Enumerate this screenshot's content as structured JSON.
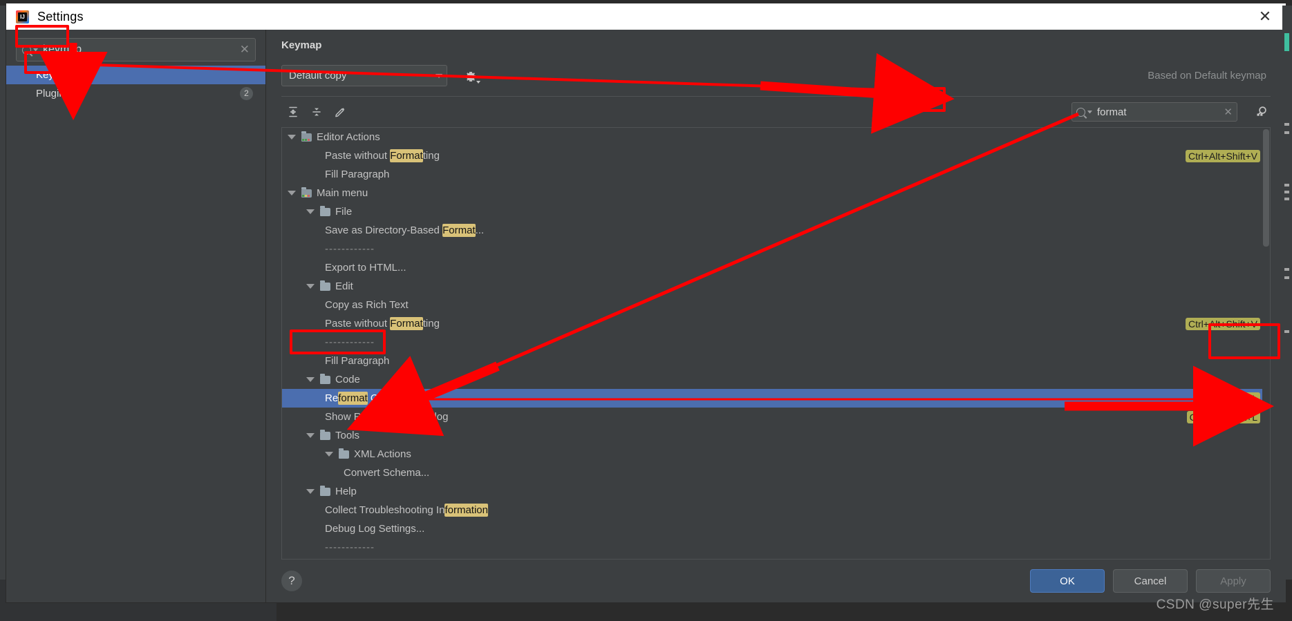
{
  "window": {
    "title": "Settings",
    "logo_icon": "intellij-idea-logo",
    "close_icon": "close-icon"
  },
  "sidebar": {
    "search": {
      "value": "keymap",
      "placeholder": "",
      "icon": "search-icon",
      "clear_icon": "clear-icon"
    },
    "items": [
      {
        "label": "Keymap",
        "selected": true,
        "badge": ""
      },
      {
        "label": "Plugins",
        "selected": false,
        "badge": "2"
      }
    ]
  },
  "main": {
    "page_title": "Keymap",
    "keymap_select": {
      "value": "Default copy",
      "caret_icon": "chevron-down-icon"
    },
    "gear_icon": "gear-icon",
    "based_on": "Based on Default keymap",
    "toolbar": {
      "expand_all_icon": "expand-all-icon",
      "collapse_all_icon": "collapse-all-icon",
      "edit_shortcut_icon": "pencil-edit-icon"
    },
    "keymap_search": {
      "value": "format",
      "icon": "search-icon",
      "clear_icon": "clear-icon"
    },
    "find_by_shortcut_icon": "find-by-shortcut-icon",
    "tree": [
      {
        "depth": 0,
        "type": "group",
        "icon": "editor-actions-icon",
        "text": "Editor Actions",
        "hl": [],
        "shortcut": ""
      },
      {
        "depth": 2,
        "type": "action",
        "icon": "",
        "text": "Paste without Formatting",
        "hl": [
          [
            "Paste without ",
            false
          ],
          [
            "Format",
            true
          ],
          [
            "ting",
            false
          ]
        ],
        "shortcut": "Ctrl+Alt+Shift+V"
      },
      {
        "depth": 2,
        "type": "action",
        "icon": "",
        "text": "Fill Paragraph",
        "hl": [],
        "shortcut": ""
      },
      {
        "depth": 0,
        "type": "group",
        "icon": "main-menu-icon",
        "text": "Main menu",
        "hl": [],
        "shortcut": ""
      },
      {
        "depth": 1,
        "type": "folder",
        "icon": "folder-icon",
        "text": "File",
        "hl": [],
        "shortcut": ""
      },
      {
        "depth": 2,
        "type": "action",
        "icon": "",
        "text": "Save as Directory-Based Format...",
        "hl": [
          [
            "Save as Directory-Based ",
            false
          ],
          [
            "Format",
            true
          ],
          [
            "...",
            false
          ]
        ],
        "shortcut": ""
      },
      {
        "depth": 2,
        "type": "separator",
        "icon": "",
        "text": "------------",
        "hl": [],
        "shortcut": ""
      },
      {
        "depth": 2,
        "type": "action",
        "icon": "",
        "text": "Export to HTML...",
        "hl": [],
        "shortcut": ""
      },
      {
        "depth": 1,
        "type": "folder",
        "icon": "folder-icon",
        "text": "Edit",
        "hl": [],
        "shortcut": ""
      },
      {
        "depth": 2,
        "type": "action",
        "icon": "",
        "text": "Copy as Rich Text",
        "hl": [],
        "shortcut": ""
      },
      {
        "depth": 2,
        "type": "action",
        "icon": "",
        "text": "Paste without Formatting",
        "hl": [
          [
            "Paste without ",
            false
          ],
          [
            "Format",
            true
          ],
          [
            "ting",
            false
          ]
        ],
        "shortcut": "Ctrl+Alt+Shift+V"
      },
      {
        "depth": 2,
        "type": "separator",
        "icon": "",
        "text": "------------",
        "hl": [],
        "shortcut": ""
      },
      {
        "depth": 2,
        "type": "action",
        "icon": "",
        "text": "Fill Paragraph",
        "hl": [],
        "shortcut": ""
      },
      {
        "depth": 1,
        "type": "folder",
        "icon": "folder-icon",
        "text": "Code",
        "hl": [],
        "shortcut": ""
      },
      {
        "depth": 2,
        "type": "action",
        "icon": "",
        "text": "Reformat Code",
        "hl": [
          [
            "Re",
            false
          ],
          [
            "format",
            true
          ],
          [
            " Code",
            false
          ]
        ],
        "shortcut": "Ctrl+Alt+L",
        "selected": true
      },
      {
        "depth": 2,
        "type": "action",
        "icon": "",
        "text": "Show Reformat File Dialog",
        "hl": [
          [
            "Show Re",
            false
          ],
          [
            "format",
            true
          ],
          [
            " File Dialog",
            false
          ]
        ],
        "shortcut": "Ctrl+Alt+Shift+L"
      },
      {
        "depth": 1,
        "type": "folder",
        "icon": "folder-icon",
        "text": "Tools",
        "hl": [],
        "shortcut": ""
      },
      {
        "depth": 2,
        "type": "folder",
        "icon": "folder-icon",
        "text": "XML Actions",
        "hl": [],
        "shortcut": ""
      },
      {
        "depth": 3,
        "type": "action",
        "icon": "",
        "text": "Convert Schema...",
        "hl": [],
        "shortcut": ""
      },
      {
        "depth": 1,
        "type": "folder",
        "icon": "folder-icon",
        "text": "Help",
        "hl": [],
        "shortcut": ""
      },
      {
        "depth": 2,
        "type": "action",
        "icon": "",
        "text": "Collect Troubleshooting Information",
        "hl": [
          [
            "Collect Troubleshooting In",
            false
          ],
          [
            "formation",
            true
          ]
        ],
        "shortcut": ""
      },
      {
        "depth": 2,
        "type": "action",
        "icon": "",
        "text": "Debug Log Settings...",
        "hl": [],
        "shortcut": ""
      },
      {
        "depth": 2,
        "type": "separator",
        "icon": "",
        "text": "------------",
        "hl": [],
        "shortcut": ""
      }
    ]
  },
  "footer": {
    "help_icon": "help-question-icon",
    "buttons": [
      {
        "label": "OK",
        "kind": "primary"
      },
      {
        "label": "Cancel",
        "kind": "normal"
      },
      {
        "label": "Apply",
        "kind": "disabled"
      }
    ]
  },
  "watermark": "CSDN @super先生",
  "colors": {
    "accent_selection": "#4b6eaf",
    "highlight_match": "#d9c278",
    "shortcut_badge": "#b0ae54",
    "annotation_red": "#fe0000",
    "window_bg": "#3c3f41",
    "primary_button": "#3c6397"
  }
}
